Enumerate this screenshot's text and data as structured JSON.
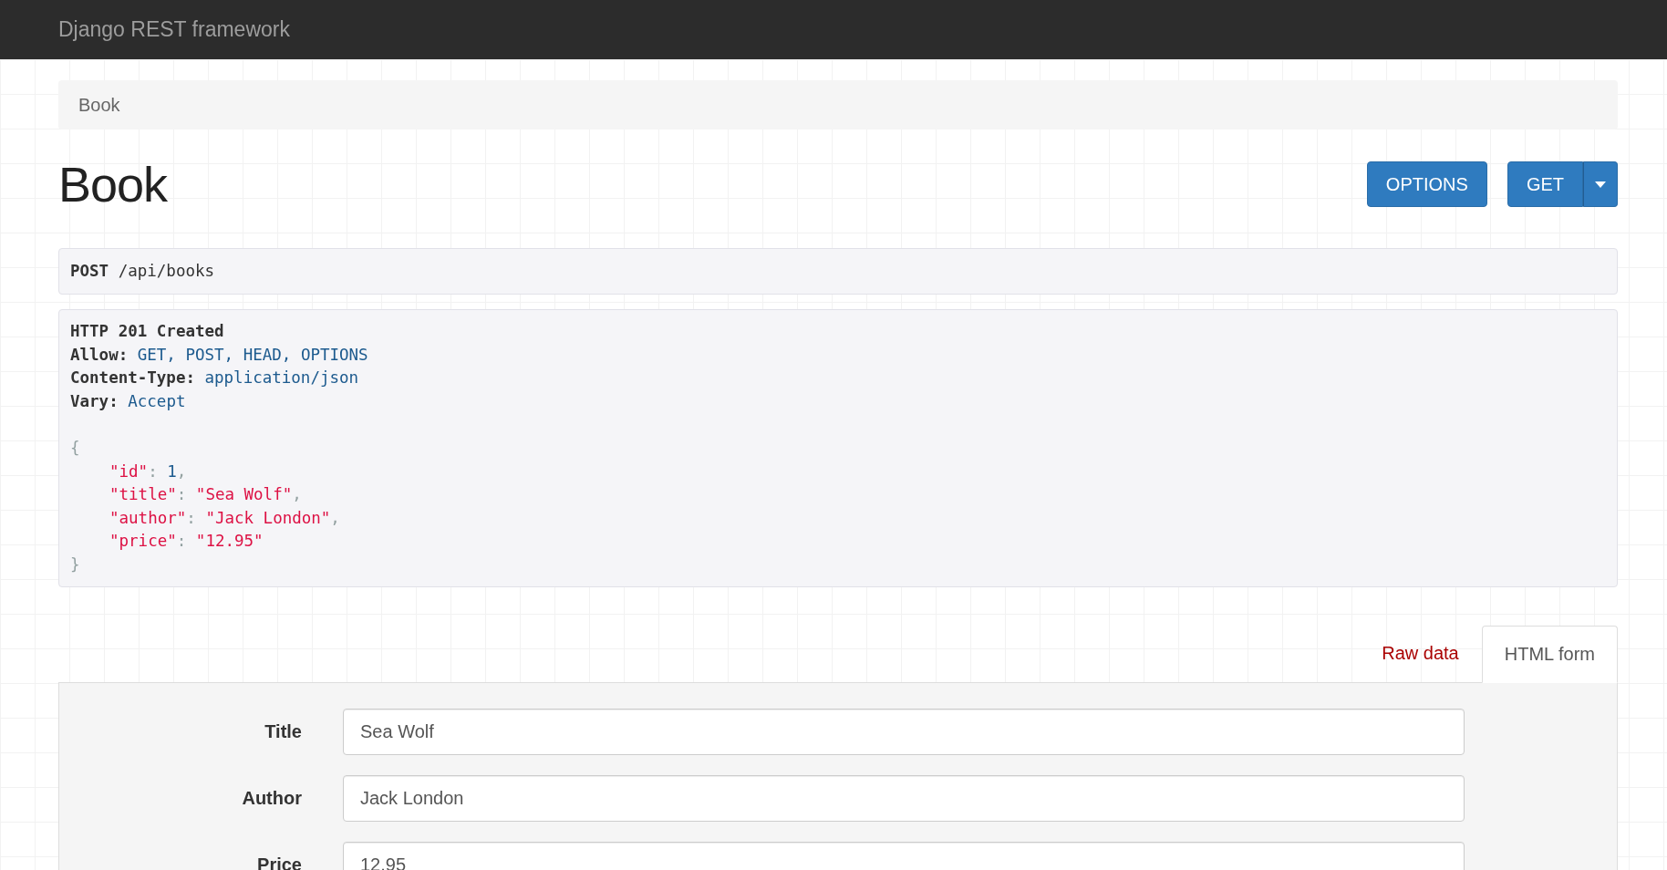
{
  "navbar": {
    "brand": "Django REST framework"
  },
  "breadcrumb": [
    {
      "label": "Book"
    }
  ],
  "page_title": "Book",
  "actions": [
    {
      "label": "OPTIONS",
      "kind": "button"
    },
    {
      "label": "GET",
      "kind": "split"
    }
  ],
  "request": {
    "method": "POST",
    "path": "/api/books"
  },
  "response": {
    "status": "HTTP 201 Created",
    "headers": [
      {
        "name": "Allow:",
        "value": "GET, POST, HEAD, OPTIONS"
      },
      {
        "name": "Content-Type:",
        "value": "application/json"
      },
      {
        "name": "Vary:",
        "value": "Accept"
      }
    ],
    "body": {
      "open": "{",
      "close": "}",
      "members": [
        {
          "key": "\"id\"",
          "sep": ": ",
          "value": "1",
          "kind": "number",
          "comma": ","
        },
        {
          "key": "\"title\"",
          "sep": ": ",
          "value": "\"Sea Wolf\"",
          "kind": "string",
          "comma": ","
        },
        {
          "key": "\"author\"",
          "sep": ": ",
          "value": "\"Jack London\"",
          "kind": "string",
          "comma": ","
        },
        {
          "key": "\"price\"",
          "sep": ": ",
          "value": "\"12.95\"",
          "kind": "string"
        }
      ]
    }
  },
  "tabs": [
    {
      "label": "Raw data",
      "selected": false
    },
    {
      "label": "HTML form",
      "selected": true
    }
  ],
  "form": {
    "fields": [
      {
        "label": "Title",
        "value": "Sea Wolf"
      },
      {
        "label": "Author",
        "value": "Jack London"
      },
      {
        "label": "Price",
        "value": "12.95"
      }
    ]
  }
}
